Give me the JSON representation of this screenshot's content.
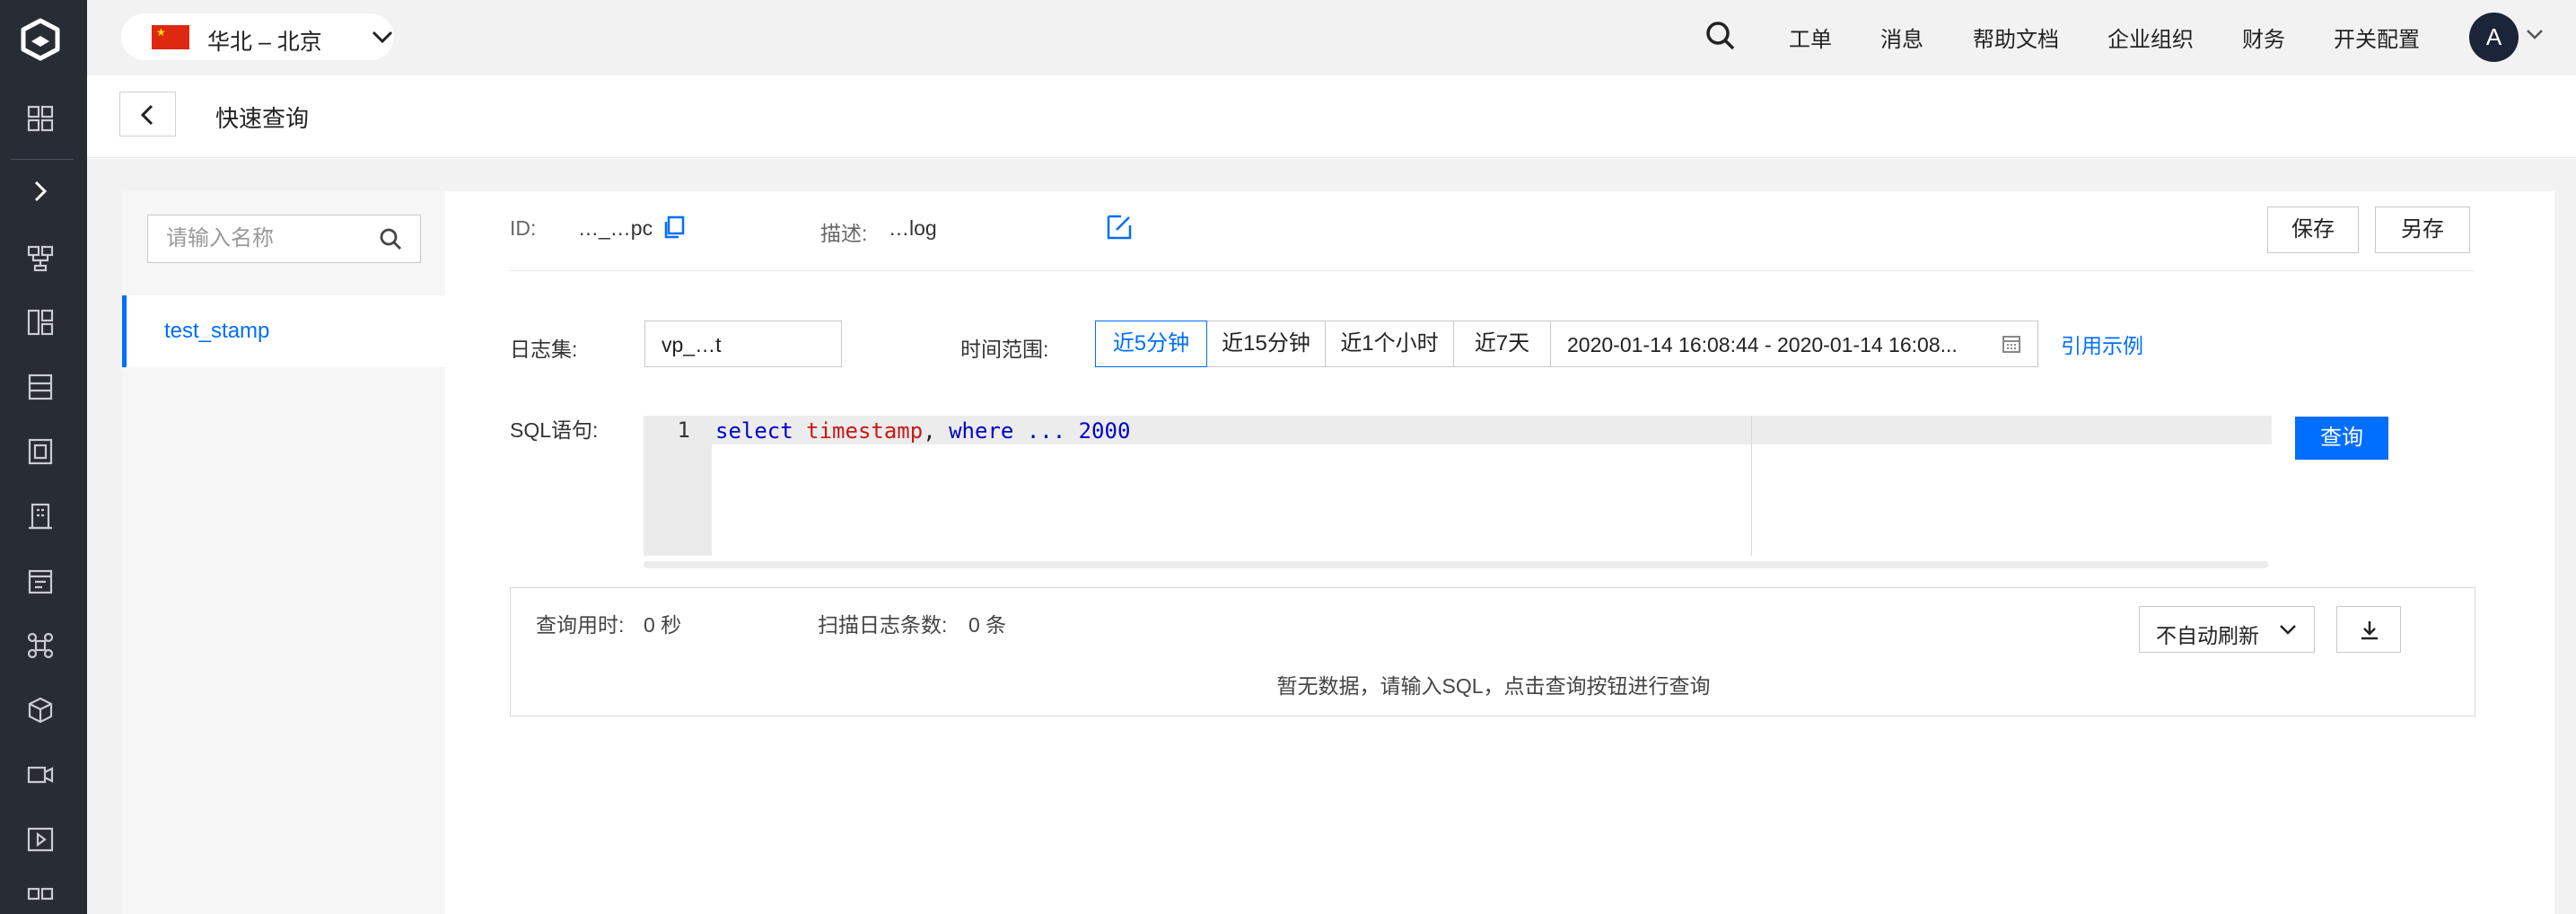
{
  "region": {
    "flag": "china-flag-icon",
    "label": "华北 – 北京"
  },
  "topnav": {
    "items": [
      "工单",
      "消息",
      "帮助文档",
      "企业组织",
      "财务",
      "开关配置"
    ],
    "avatar_letter": "A"
  },
  "header": {
    "title": "快速查询"
  },
  "sidebar": {
    "search_placeholder": "请输入名称",
    "items": [
      {
        "label": "test_stamp"
      }
    ]
  },
  "detail": {
    "id_label": "ID:",
    "id_value": "…_…pc",
    "desc_label": "描述:",
    "desc_value": "…log",
    "save_label": "保存",
    "save_as_label": "另存"
  },
  "query_form": {
    "logset_label": "日志集:",
    "logset_value": "vp_…t",
    "time_label": "时间范围:",
    "time_options": [
      "近5分钟",
      "近15分钟",
      "近1个小时",
      "近7天"
    ],
    "active_option": "近5分钟",
    "time_range": "2020-01-14 16:08:44 - 2020-01-14 16:08...",
    "example_link": "引用示例",
    "sql_label": "SQL语句:",
    "sql_line_number": "1",
    "sql_tokens": {
      "kw_select": "select",
      "fn": " timestamp",
      "rest": ", ",
      "kw_where": " where ",
      "tail": " ... 2000"
    },
    "query_button": "查询"
  },
  "result": {
    "time_label": "查询用时:",
    "time_value": "0 秒",
    "scan_label": "扫描日志条数:",
    "scan_value": "0 条",
    "refresh_option": "不自动刷新",
    "empty_message": "暂无数据，请输入SQL，点击查询按钮进行查询"
  },
  "colors": {
    "accent": "#006eff",
    "rail": "#282c34",
    "bg": "#f2f2f2"
  }
}
